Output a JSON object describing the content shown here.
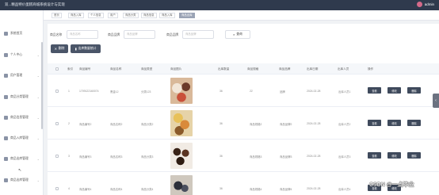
{
  "header": {
    "title": "双...精品特价蛋糕商城系统设计与实现",
    "user": "admin"
  },
  "sidebar": {
    "items": [
      {
        "label": "系统首页",
        "icon": "home-icon"
      },
      {
        "label": "个人中心",
        "icon": "user-icon"
      },
      {
        "label": "用户管理",
        "icon": "users-icon"
      },
      {
        "label": "商品分类管理",
        "icon": "category-icon"
      },
      {
        "label": "商品信息管理",
        "icon": "goods-icon"
      },
      {
        "label": "商品入库管理",
        "icon": "inbound-icon"
      },
      {
        "label": "商品出库管理",
        "icon": "outbound-icon"
      },
      {
        "label": "商品出库管理",
        "icon": "outbound-icon"
      }
    ]
  },
  "tabs": [
    "首页",
    "商品入库",
    "个人信息",
    "用户",
    "商品分类",
    "商品信息",
    "商品入库",
    "商品出库"
  ],
  "search": {
    "label1": "商品名称",
    "placeholder1": "商品名称",
    "label2": "商品品牌",
    "placeholder2": "商品品牌",
    "label3": "商品品牌",
    "placeholder3": "商品品牌",
    "search_btn": "查询"
  },
  "toolbar": {
    "delete_btn": "删除",
    "stats_btn": "出库数量统计"
  },
  "table": {
    "headers": [
      "索引",
      "商品编号",
      "商品名称",
      "商品类型",
      "商品图片",
      "出库数量",
      "商品规格",
      "商品品牌",
      "出库日期",
      "出库人员",
      "操作"
    ],
    "rows": [
      {
        "index": "1",
        "code": "1709122160074",
        "name": "黑金12",
        "type": "分类123",
        "qty": "36",
        "spec": "22",
        "brand": "品牌",
        "date": "2024-02-28",
        "staff": "出库人员1"
      },
      {
        "index": "2",
        "code": "商品编号2",
        "name": "商品名称2",
        "type": "商品分类2",
        "qty": "36",
        "spec": "商品规格2",
        "brand": "商品品牌2",
        "date": "2024-02-28",
        "staff": "出库人员2"
      },
      {
        "index": "3",
        "code": "商品编号3",
        "name": "商品名称3",
        "type": "商品分类3",
        "qty": "36",
        "spec": "商品规格3",
        "brand": "商品品牌3",
        "date": "2024-02-28",
        "staff": "出库人员3"
      },
      {
        "index": "4",
        "code": "商品编号4",
        "name": "商品名称4",
        "type": "商品分类4",
        "qty": "36",
        "spec": "商品规格4",
        "brand": "商品品牌4",
        "date": "2024-02-28",
        "staff": "出库人员4"
      }
    ],
    "actions": [
      "查看",
      "修改",
      "删除"
    ]
  },
  "watermark": "CSDN @一点毕业",
  "colors": {
    "topbar": "#2f3a4d",
    "accent": "#4a5568",
    "active_tab": "#9aa3b5"
  }
}
